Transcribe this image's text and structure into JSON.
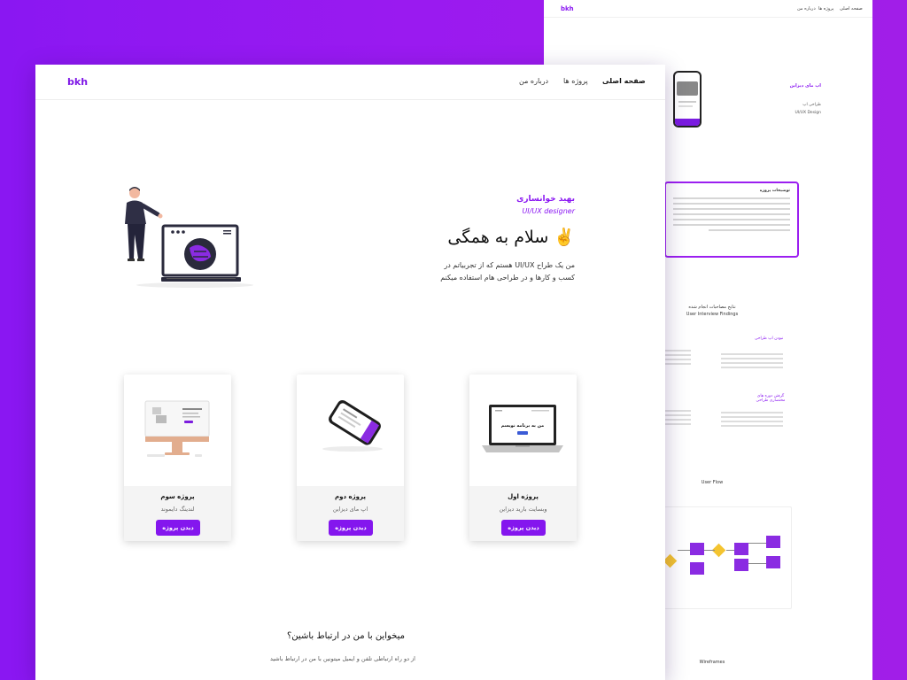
{
  "back_page": {
    "logo": "bkh",
    "nav": [
      "صفحه اصلی",
      "پروژه ها",
      "درباره من"
    ],
    "app_title": "اپ مای دیزاین",
    "meta_label": "طراحی اپ",
    "meta_value": "UI/UX Design",
    "description_title": "توضیحات پروژه",
    "interview_title": "نتایج مصاحبات انجام شده",
    "interview_subtitle": "User Interview Findings",
    "finding_1": "نبودن اپ طراحی",
    "finding_2": "گرفتن دوره های مختصاری طراحی",
    "user_flow_label": "User Flow",
    "wireframes_label": "Wireframes"
  },
  "main": {
    "logo": "bkh",
    "nav": {
      "home": "صفحه اصلی",
      "projects": "پروژه ها",
      "about": "درباره من"
    },
    "hero": {
      "name": "بهید خوانساری",
      "role": "UI/UX designer",
      "greeting": "سلام به همگی ✌️",
      "description": "من یک طراح UI/UX هستم که از تجربیاتم در کسب و کارها و در طراحی هام استفاده میکنم"
    },
    "projects": [
      {
        "title": "پروژه سوم",
        "subtitle": "لندینگ دایموند",
        "button": "دیدن پروژه"
      },
      {
        "title": "پروژه دوم",
        "subtitle": "اپ مای دیزاین",
        "button": "دیدن پروژه"
      },
      {
        "title": "پروژه اول",
        "subtitle": "وبسایت بارید دیزاین",
        "button": "دیدن پروژه"
      }
    ],
    "laptop_screen_text": "من به برنامه نویسم",
    "contact": {
      "title": "میخواین با من در ارتباط باشین؟",
      "subtitle": "از دو راه ارتباطی تلفن و ایمیل میتونین با من در ارتباط باشید"
    }
  },
  "colors": {
    "accent": "#8416ee",
    "background_gradient_start": "#8a17f2",
    "background_gradient_end": "#a11ee8"
  }
}
